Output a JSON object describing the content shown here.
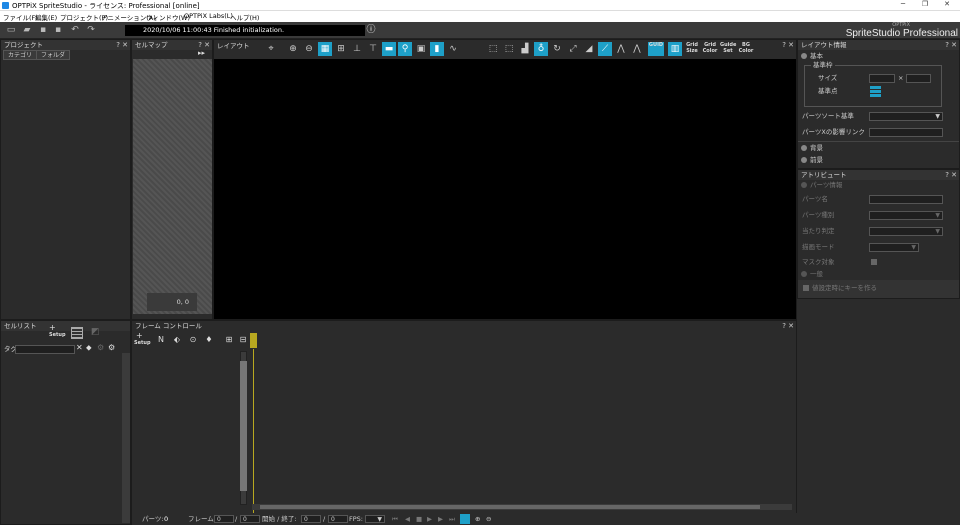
{
  "window": {
    "title": "OPTPiX SpriteStudio - ライセンス: Professional [online]",
    "min_label": "─",
    "max_label": "❐",
    "close_label": "✕"
  },
  "menu": [
    "ファイル(F)",
    "編集(E)",
    "プロジェクト(P)",
    "アニメーション(A)",
    "ウィンドウ(W)",
    "OPTPiX Labs(L)",
    "ヘルプ(H)"
  ],
  "status_text": "2020/10/06 11:00:43   Finished initialization.",
  "brand": {
    "small": "OPTPiX",
    "big": "SpriteStudio Professional"
  },
  "panels": {
    "project": {
      "title": "プロジェクト",
      "tabs": [
        "カテゴリ",
        "フォルダ"
      ]
    },
    "cellmap": {
      "title": "セルマップ",
      "coord": "0, 0"
    },
    "layout": {
      "title": "レイアウト"
    },
    "info": {
      "title": "レイアウト情報",
      "basic": "基本",
      "frame_group": "基準枠",
      "size": "サイズ",
      "times": "×",
      "origin": "基準点",
      "sort": "パーツソート基準",
      "link": "パーツXの影響リンク",
      "bg": "背景",
      "fg": "前景"
    },
    "attr": {
      "title": "アトリビュート",
      "part_info": "パーツ情報",
      "part_name": "パーツ名",
      "part_type": "パーツ種別",
      "hit": "当たり判定",
      "draw_mode": "描画モード",
      "mask": "マスク対象",
      "general": "一般",
      "key_on_set": "値設定時にキーを作る"
    },
    "celllist": {
      "title": "セルリスト",
      "tag": "タグ",
      "setup": "Setup"
    },
    "frame": {
      "title": "フレーム コントロール",
      "setup": "Setup"
    }
  },
  "layout_text_tools": [
    "GUID",
    "Grid Size",
    "Grid Color",
    "Guide Set",
    "BG Color"
  ],
  "panel_ctrl": "? ✕",
  "bottom": {
    "parts_label": "パーツ:",
    "parts_value": "0",
    "frame_label": "フレーム:",
    "frame_value": "0",
    "frame_total": "0",
    "range_label": "開始 / 終了:",
    "range_start": "0",
    "range_end": "0",
    "fps_label": "FPS:",
    "slash": "/"
  },
  "colors": {
    "accent": "#1ea0c8",
    "playhead": "#b8a820"
  }
}
